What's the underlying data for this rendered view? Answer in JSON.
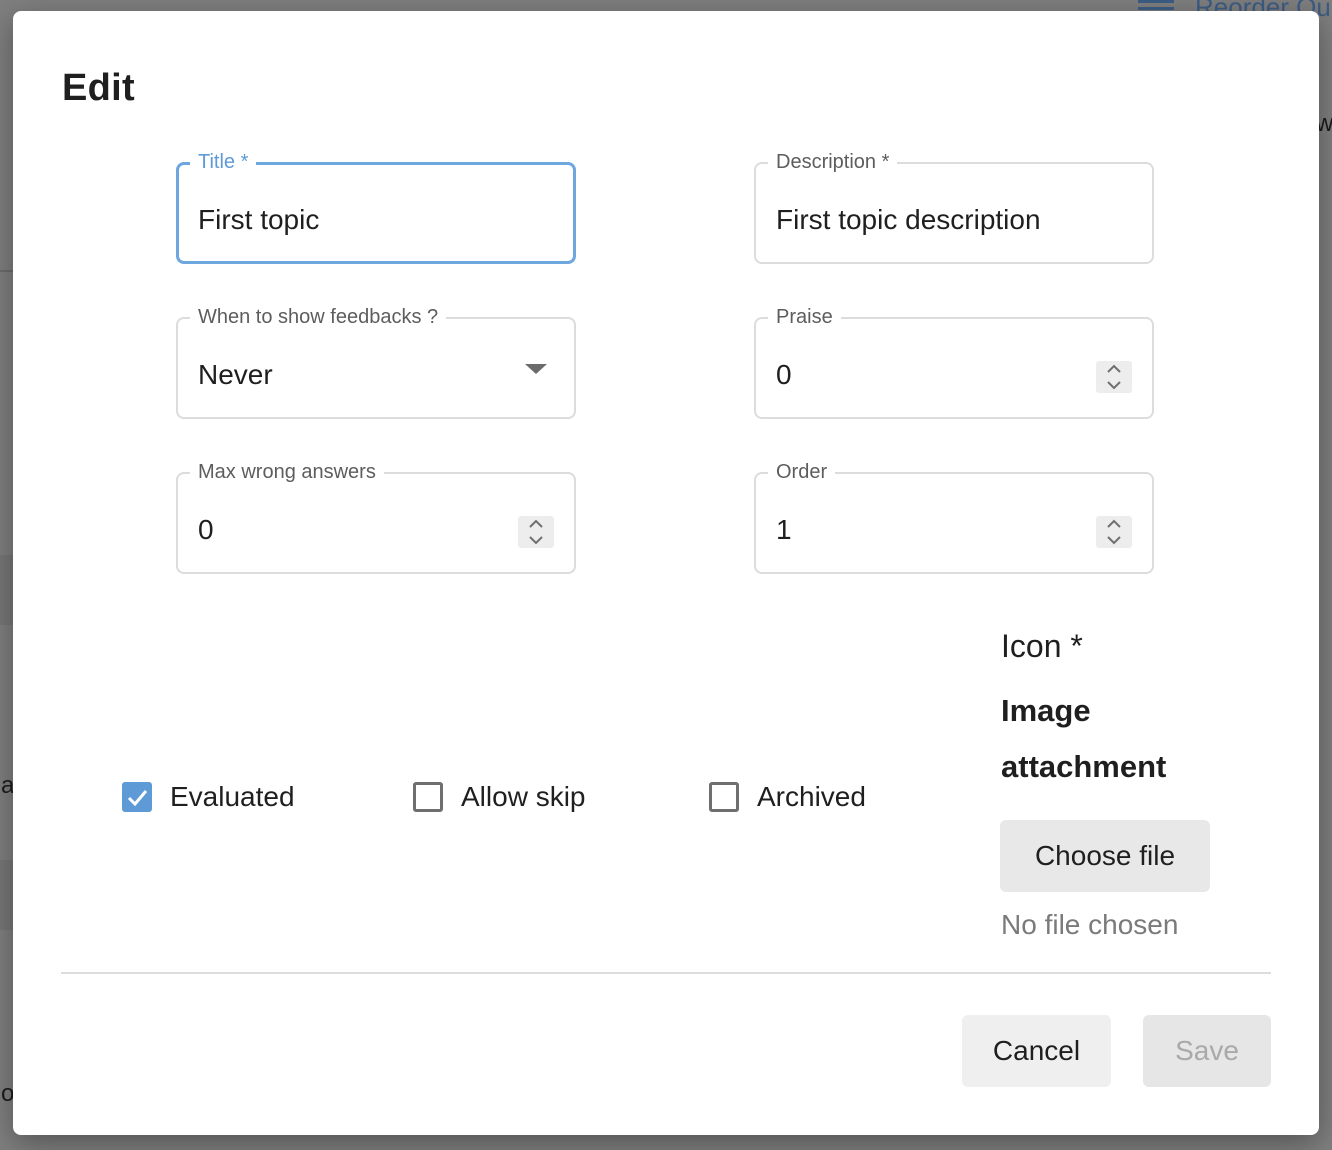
{
  "background": {
    "header_text": "Reorder Qu",
    "side_letters": [
      "w",
      "a",
      "o"
    ]
  },
  "dialog": {
    "title": "Edit",
    "fields": {
      "title": {
        "label": "Title *",
        "value": "First topic"
      },
      "description": {
        "label": "Description *",
        "value": "First topic description"
      },
      "feedback": {
        "label": "When to show feedbacks ?",
        "value": "Never"
      },
      "praise": {
        "label": "Praise",
        "value": "0"
      },
      "max_wrong": {
        "label": "Max wrong answers",
        "value": "0"
      },
      "order": {
        "label": "Order",
        "value": "1"
      }
    },
    "checkboxes": {
      "evaluated": {
        "label": "Evaluated",
        "checked": true
      },
      "allow_skip": {
        "label": "Allow skip",
        "checked": false
      },
      "archived": {
        "label": "Archived",
        "checked": false
      }
    },
    "icon": {
      "heading": "Icon *",
      "attachment_label": "Image attachment",
      "choose_button": "Choose file",
      "no_file_text": "No file chosen"
    },
    "actions": {
      "cancel": "Cancel",
      "save": "Save"
    }
  },
  "colors": {
    "accent": "#5e9ad6",
    "focused_border": "#6ea6de",
    "backdrop": "#7f7f7f"
  }
}
